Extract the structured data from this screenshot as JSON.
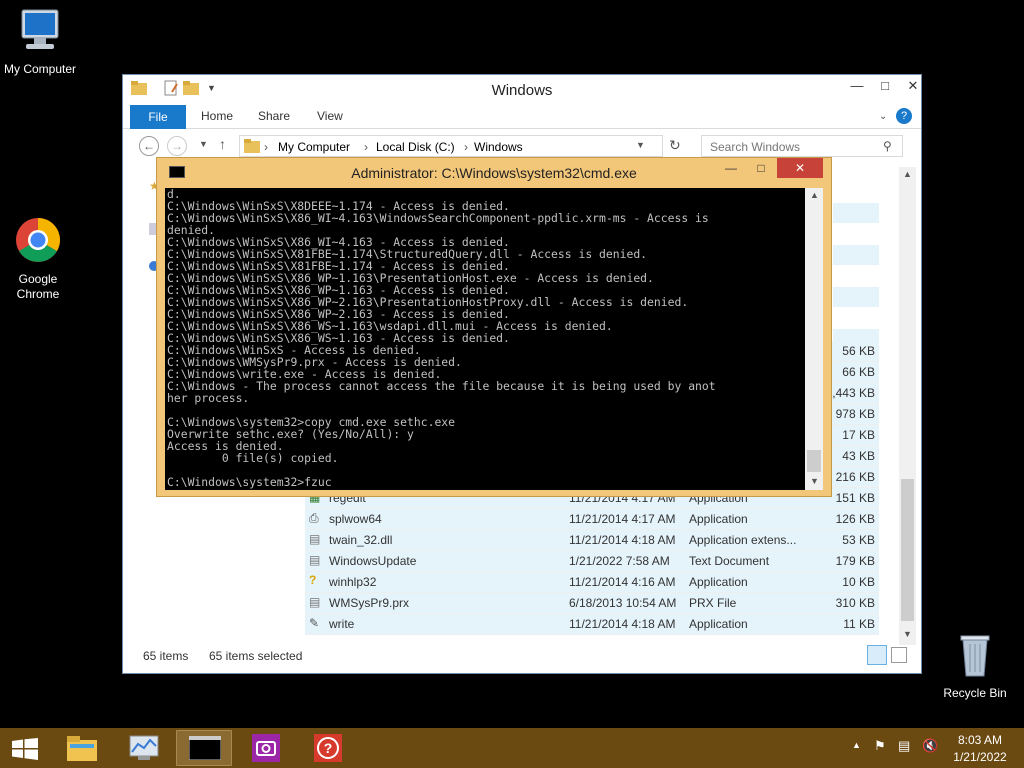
{
  "desktop": {
    "icons": [
      {
        "label": "My Computer"
      },
      {
        "label": "Google Chrome"
      },
      {
        "label": "Recycle Bin"
      }
    ]
  },
  "explorer": {
    "title": "Windows",
    "tabs": {
      "file": "File",
      "home": "Home",
      "share": "Share",
      "view": "View"
    },
    "breadcrumb": [
      "My Computer",
      "Local Disk (C:)",
      "Windows"
    ],
    "search_placeholder": "Search Windows",
    "files": [
      {
        "name": "regedit",
        "date": "11/21/2014 4:17 AM",
        "type": "Application",
        "size": "151 KB"
      },
      {
        "name": "splwow64",
        "date": "11/21/2014 4:17 AM",
        "type": "Application",
        "size": "126 KB"
      },
      {
        "name": "twain_32.dll",
        "date": "11/21/2014 4:18 AM",
        "type": "Application extens...",
        "size": "53 KB"
      },
      {
        "name": "WindowsUpdate",
        "date": "1/21/2022 7:58 AM",
        "type": "Text Document",
        "size": "179 KB"
      },
      {
        "name": "winhlp32",
        "date": "11/21/2014 4:16 AM",
        "type": "Application",
        "size": "10 KB"
      },
      {
        "name": "WMSysPr9.prx",
        "date": "6/18/2013 10:54 AM",
        "type": "PRX File",
        "size": "310 KB"
      },
      {
        "name": "write",
        "date": "11/21/2014 4:18 AM",
        "type": "Application",
        "size": "11 KB"
      }
    ],
    "partial_sizes": [
      "56 KB",
      "66 KB",
      "2,443 KB",
      "978 KB",
      "17 KB",
      "43 KB",
      "216 KB"
    ],
    "status": {
      "items": "65 items",
      "selected": "65 items selected"
    }
  },
  "cmd": {
    "title": "Administrator: C:\\Windows\\system32\\cmd.exe",
    "lines": [
      "d.",
      "C:\\Windows\\WinSxS\\X8DEEE~1.174 - Access is denied.",
      "C:\\Windows\\WinSxS\\X86_WI~4.163\\WindowsSearchComponent-ppdlic.xrm-ms - Access is",
      "denied.",
      "C:\\Windows\\WinSxS\\X86_WI~4.163 - Access is denied.",
      "C:\\Windows\\WinSxS\\X81FBE~1.174\\StructuredQuery.dll - Access is denied.",
      "C:\\Windows\\WinSxS\\X81FBE~1.174 - Access is denied.",
      "C:\\Windows\\WinSxS\\X86_WP~1.163\\PresentationHost.exe - Access is denied.",
      "C:\\Windows\\WinSxS\\X86_WP~1.163 - Access is denied.",
      "C:\\Windows\\WinSxS\\X86_WP~2.163\\PresentationHostProxy.dll - Access is denied.",
      "C:\\Windows\\WinSxS\\X86_WP~2.163 - Access is denied.",
      "C:\\Windows\\WinSxS\\X86_WS~1.163\\wsdapi.dll.mui - Access is denied.",
      "C:\\Windows\\WinSxS\\X86_WS~1.163 - Access is denied.",
      "C:\\Windows\\WinSxS - Access is denied.",
      "C:\\Windows\\WMSysPr9.prx - Access is denied.",
      "C:\\Windows\\write.exe - Access is denied.",
      "C:\\Windows - The process cannot access the file because it is being used by anot",
      "her process.",
      "",
      "C:\\Windows\\system32>copy cmd.exe sethc.exe",
      "Overwrite sethc.exe? (Yes/No/All): y",
      "Access is denied.",
      "        0 file(s) copied.",
      "",
      "C:\\Windows\\system32>fzuc"
    ]
  },
  "taskbar": {
    "time": "8:03 AM",
    "date": "1/21/2022"
  }
}
